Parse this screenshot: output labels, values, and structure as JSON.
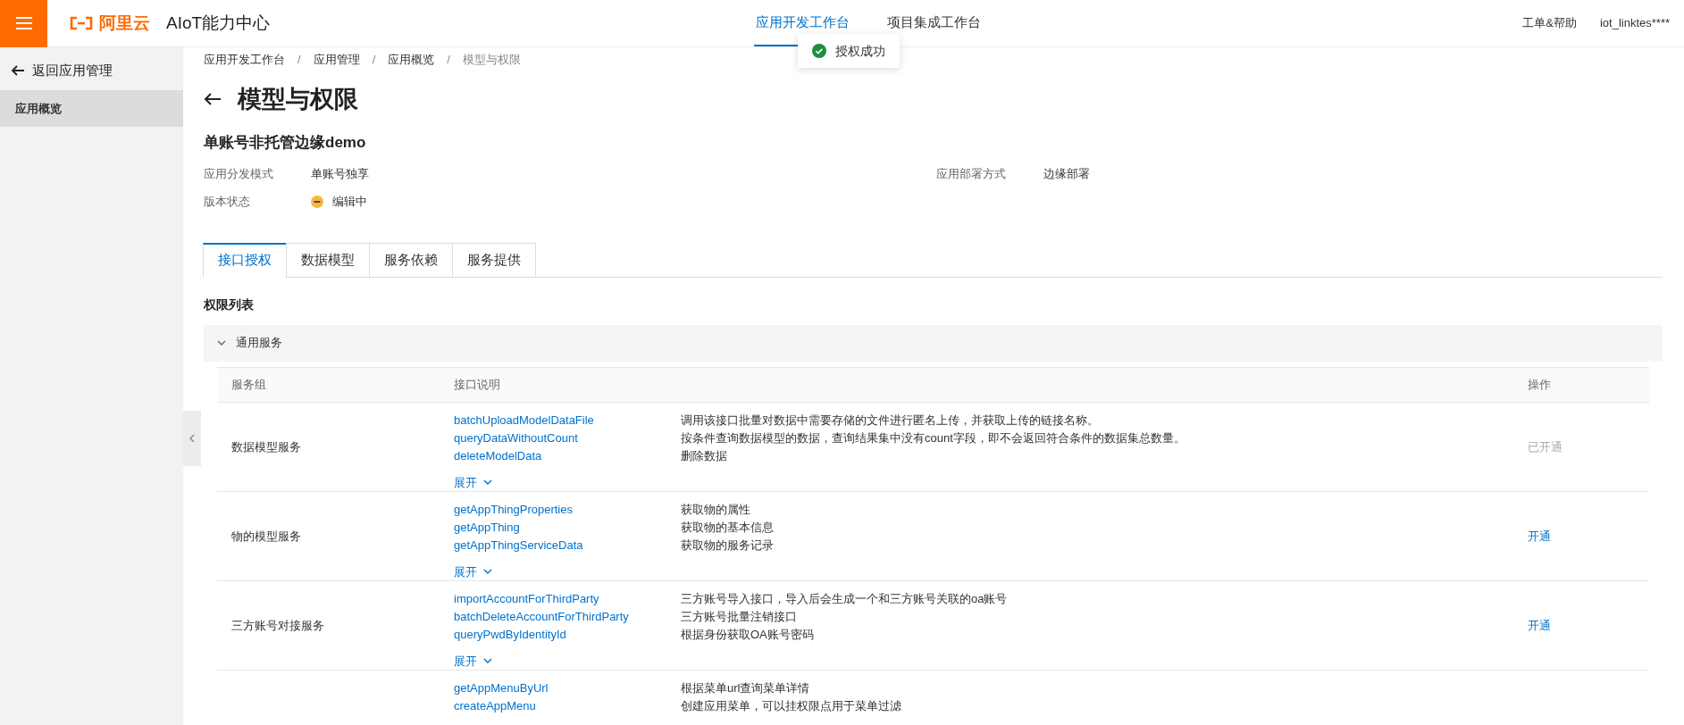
{
  "header": {
    "logo_text": "阿里云",
    "product": "AIoT能力中心",
    "nav": [
      {
        "label": "应用开发工作台",
        "selected": true
      },
      {
        "label": "项目集成工作台",
        "selected": false
      }
    ],
    "links": [
      "工单&帮助",
      "iot_linktes****"
    ]
  },
  "toast": {
    "message": "授权成功"
  },
  "sidebar": {
    "back": "返回应用管理",
    "items": [
      {
        "label": "应用概览",
        "selected": true
      }
    ]
  },
  "breadcrumb_separator": "/",
  "breadcrumb": [
    "应用开发工作台",
    "应用管理",
    "应用概览",
    "模型与权限"
  ],
  "page_title": "模型与权限",
  "app": {
    "name": "单账号非托管边缘demo",
    "fields": [
      {
        "label": "应用分发模式",
        "value": "单账号独享"
      },
      {
        "label": "应用部署方式",
        "value": "边缘部署"
      },
      {
        "label": "版本状态",
        "value": "编辑中",
        "status": true
      }
    ]
  },
  "tabs": [
    {
      "label": "接口授权",
      "selected": true
    },
    {
      "label": "数据模型",
      "selected": false
    },
    {
      "label": "服务依赖",
      "selected": false
    },
    {
      "label": "服务提供",
      "selected": false
    }
  ],
  "section_title": "权限列表",
  "group": {
    "title": "通用服务",
    "expanded": true
  },
  "table": {
    "columns": [
      "服务组",
      "接口说明",
      "操作"
    ],
    "rows": [
      {
        "group": "数据模型服务",
        "apis": [
          {
            "name": "batchUploadModelDataFile",
            "description": "调用该接口批量对数据中需要存储的文件进行匿名上传，并获取上传的链接名称。"
          },
          {
            "name": "queryDataWithoutCount",
            "description": "按条件查询数据模型的数据，查询结果集中没有count字段，即不会返回符合条件的数据集总数量。"
          },
          {
            "name": "deleteModelData",
            "description": "删除数据"
          }
        ],
        "more": "展开",
        "action": "已开通",
        "activated": true
      },
      {
        "group": "物的模型服务",
        "apis": [
          {
            "name": "getAppThingProperties",
            "description": "获取物的属性"
          },
          {
            "name": "getAppThing",
            "description": "获取物的基本信息"
          },
          {
            "name": "getAppThingServiceData",
            "description": "获取物的服务记录"
          }
        ],
        "more": "展开",
        "action": "开通",
        "activated": false
      },
      {
        "group": "三方账号对接服务",
        "apis": [
          {
            "name": "importAccountForThirdParty",
            "description": "三方账号导入接口，导入后会生成一个和三方账号关联的oa账号"
          },
          {
            "name": "batchDeleteAccountForThirdParty",
            "description": "三方账号批量注销接口"
          },
          {
            "name": "queryPwdByIdentityId",
            "description": "根据身份获取OA账号密码"
          }
        ],
        "more": "展开",
        "action": "开通",
        "activated": false
      },
      {
        "apis": [
          {
            "name": "getAppMenuByUrl",
            "description": "根据菜单url查询菜单详情"
          },
          {
            "name": "createAppMenu",
            "description": "创建应用菜单，可以挂权限点用于菜单过滤"
          }
        ]
      }
    ]
  }
}
